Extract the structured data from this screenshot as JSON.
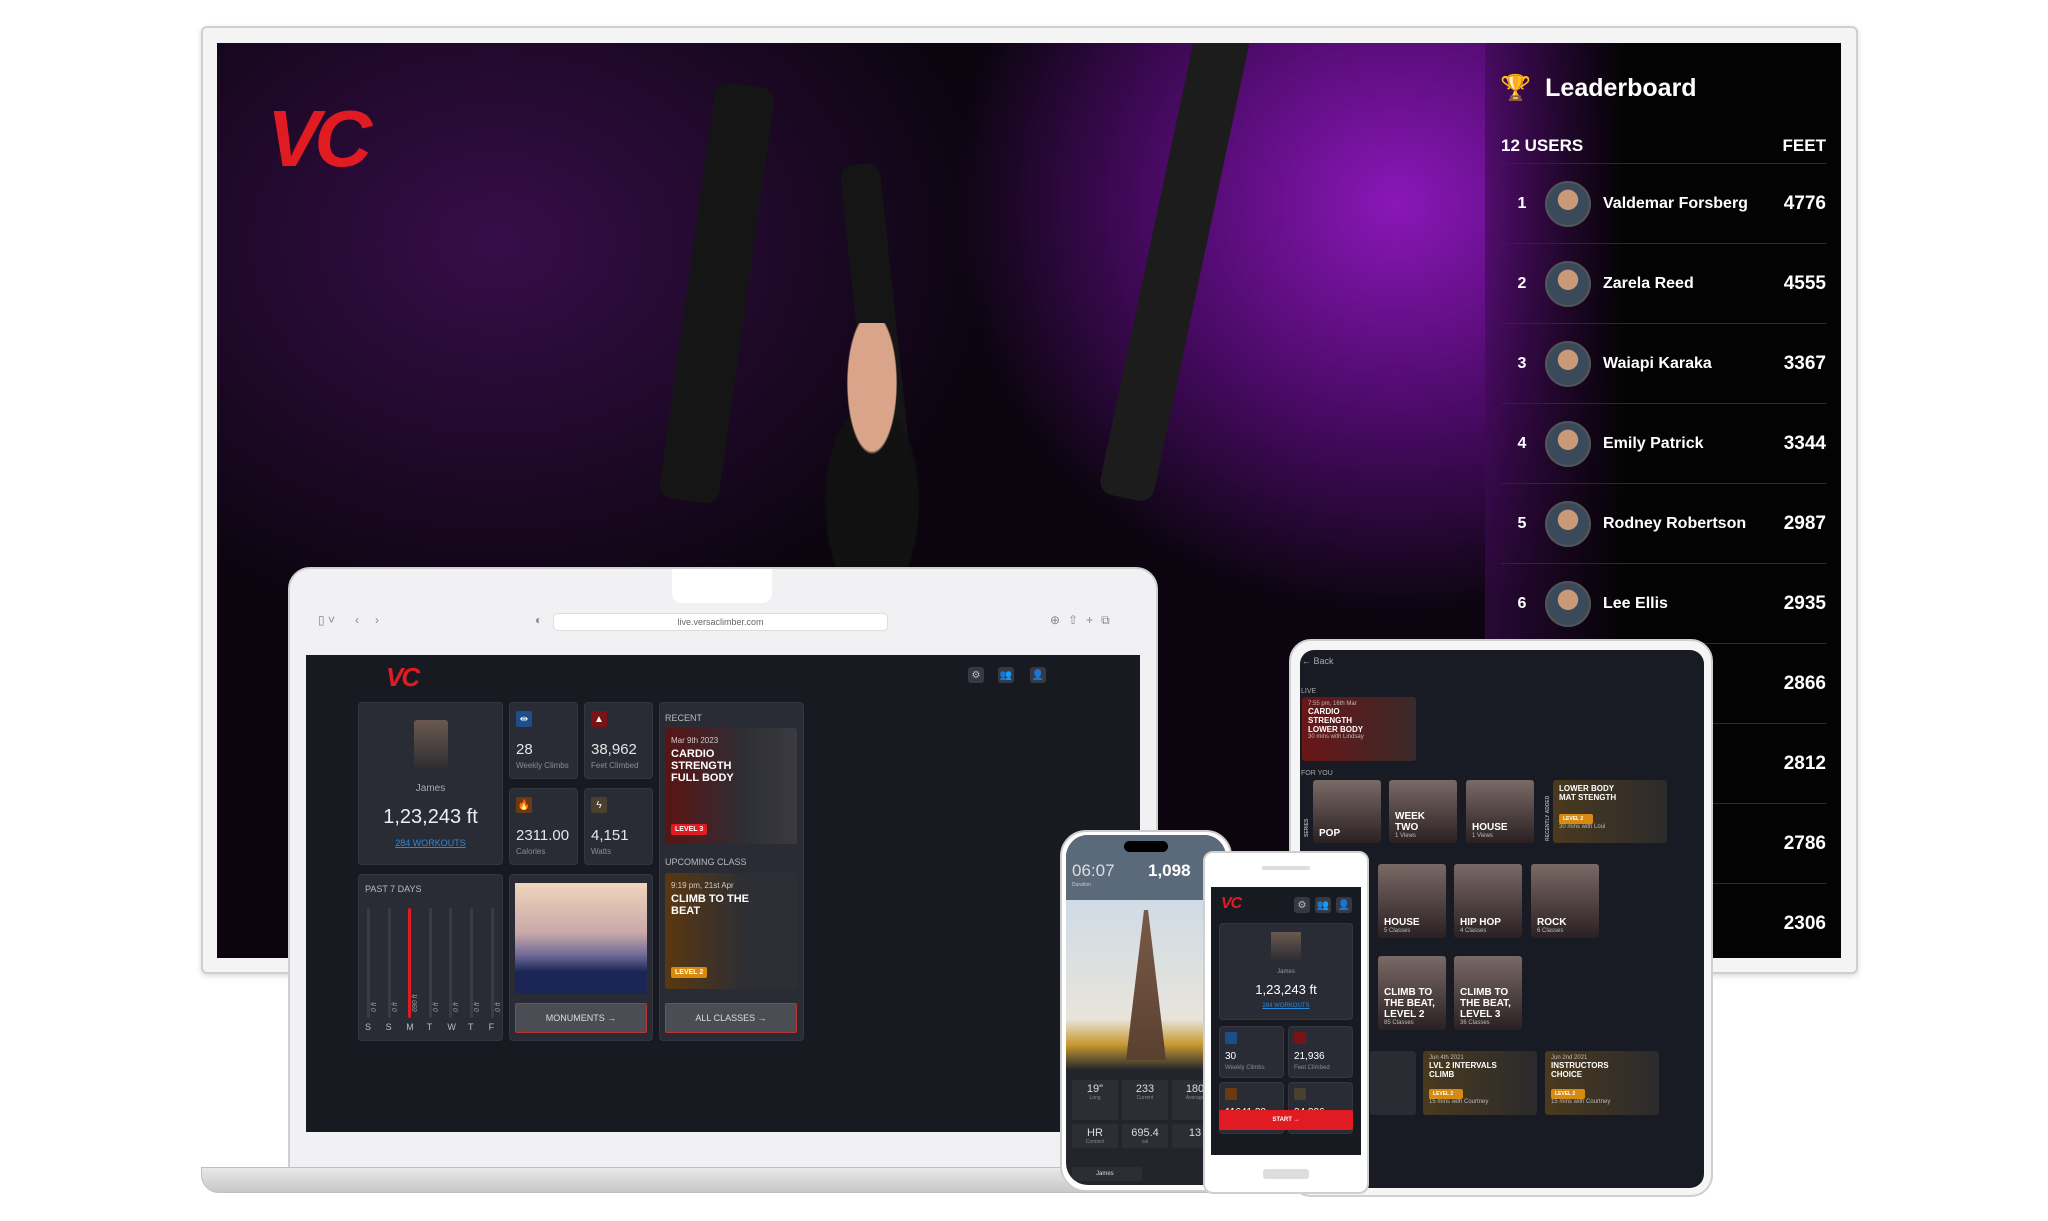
{
  "brand": {
    "logo": "VC",
    "accent": "#e01b22",
    "bg": "#181a22"
  },
  "leaderboard": {
    "title": "Leaderboard",
    "icon": "trophy-icon",
    "users_label": "12 USERS",
    "feet_label": "FEET",
    "rows": [
      {
        "rank": "1",
        "name": "Valdemar Forsberg",
        "feet": "4776"
      },
      {
        "rank": "2",
        "name": "Zarela Reed",
        "feet": "4555"
      },
      {
        "rank": "3",
        "name": "Waiapi Karaka",
        "feet": "3367"
      },
      {
        "rank": "4",
        "name": "Emily Patrick",
        "feet": "3344"
      },
      {
        "rank": "5",
        "name": "Rodney Robertson",
        "feet": "2987"
      },
      {
        "rank": "6",
        "name": "Lee Ellis",
        "feet": "2935"
      },
      {
        "feet": "2866"
      },
      {
        "feet": "2812"
      },
      {
        "feet": "2786"
      },
      {
        "feet": "2306"
      }
    ]
  },
  "browser": {
    "url": "live.versaclimber.com"
  },
  "dashboard": {
    "user": "James",
    "total": "1,23,243 ft",
    "workouts": "284 WORKOUTS",
    "stats": [
      {
        "value": "28",
        "label": "Weekly Climbs"
      },
      {
        "value": "38,962",
        "label": "Feet Climbed"
      },
      {
        "value": "2311.00",
        "label": "Calories"
      },
      {
        "value": "4,151",
        "label": "Watts"
      }
    ],
    "past7": {
      "title": "PAST 7 DAYS",
      "days": [
        {
          "d": "S",
          "v": "0 ft"
        },
        {
          "d": "S",
          "v": "0 ft"
        },
        {
          "d": "M",
          "v": "690 ft"
        },
        {
          "d": "T",
          "v": "0 ft"
        },
        {
          "d": "W",
          "v": "0 ft"
        },
        {
          "d": "T",
          "v": "0 ft"
        },
        {
          "d": "F",
          "v": "0 ft"
        }
      ]
    },
    "monuments_btn": "MONUMENTS →",
    "recent": {
      "label": "RECENT",
      "date": "Mar 9th 2023",
      "title": "CARDIO STRENGTH FULL BODY",
      "level": "LEVEL 3"
    },
    "upcoming": {
      "label": "UPCOMING CLASS",
      "date": "9:19 pm, 21st Apr",
      "title": "CLIMB TO THE BEAT",
      "level": "LEVEL 2"
    },
    "all_classes_btn": "ALL CLASSES →"
  },
  "tablet": {
    "back": "Back",
    "live_label": "LIVE",
    "live": {
      "date": "7:55 pm, 16th Mar",
      "title": "CARDIO STRENGTH LOWER BODY",
      "sub": "30 mins with Lindsay"
    },
    "for_you": "FOR YOU",
    "side_series": "SERIES",
    "side_recent": "RECENTLY ADDED",
    "row1": [
      {
        "t": "POP",
        "s": ""
      },
      {
        "t": "WEEK TWO",
        "s": "1 Views"
      },
      {
        "t": "HOUSE",
        "s": "1 Views"
      }
    ],
    "lower": {
      "title": "LOWER BODY MAT STENGTH",
      "level": "LEVEL 2",
      "sub": "30 mins with Loui"
    },
    "row2": [
      {
        "t": "HOUSE",
        "s": "5 Classes"
      },
      {
        "t": "HIP HOP",
        "s": "4 Classes"
      },
      {
        "t": "ROCK",
        "s": "6 Classes"
      }
    ],
    "row3": [
      {
        "t": "CLIMB TO THE BEAT, LEVEL 2",
        "s": "85 Classes"
      },
      {
        "t": "CLIMB TO THE BEAT, LEVEL 3",
        "s": "36 Classes"
      }
    ],
    "row4": [
      {
        "date": "Jun 4th 2021",
        "t": "LVL 2 INTERVALS CLIMB",
        "level": "LEVEL 2",
        "s": "15 mins with Courtney"
      },
      {
        "date": "Jun 2nd 2021",
        "t": "INSTRUCTORS CHOICE",
        "level": "LEVEL 2",
        "s": "15 mins with Courtney"
      }
    ]
  },
  "iphone": {
    "duration": "06:07",
    "duration_label": "Duration",
    "feet": "1,098",
    "stats": [
      {
        "v": "19\"",
        "l": "Long"
      },
      {
        "v": "233",
        "l": "Current"
      },
      {
        "v": "180",
        "l": "Average"
      },
      {
        "v": "HR",
        "l": "Connect"
      },
      {
        "v": "695.4",
        "l": "cal"
      },
      {
        "v": "13",
        "l": ""
      }
    ],
    "user": "James"
  },
  "android": {
    "user": "James",
    "total": "1,23,243 ft",
    "workouts": "284 WORKOUTS",
    "stats": [
      {
        "value": "30",
        "label": "Weekly Climbs"
      },
      {
        "value": "21,936",
        "label": "Feet Climbed"
      },
      {
        "value": "11641.30",
        "label": ""
      },
      {
        "value": "34,806",
        "label": ""
      }
    ],
    "start": "START →"
  }
}
